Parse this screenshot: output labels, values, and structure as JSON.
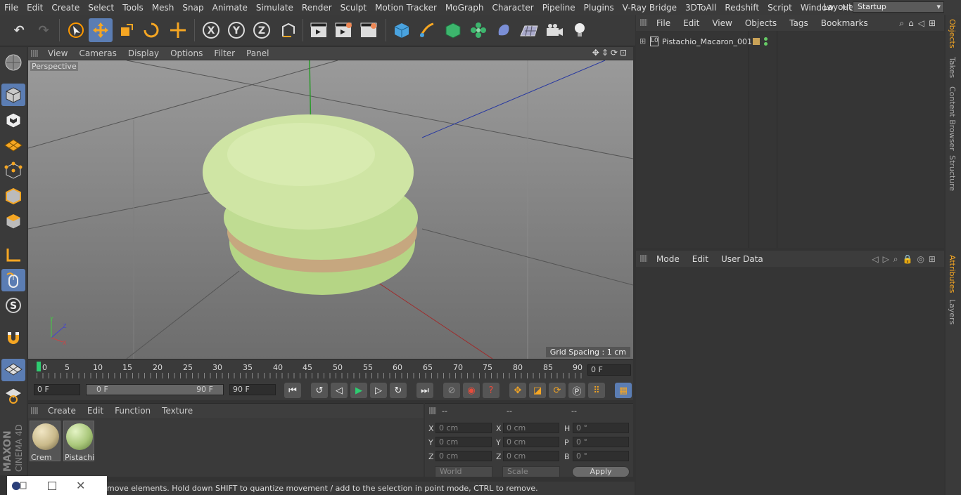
{
  "menubar": {
    "items": [
      "File",
      "Edit",
      "Create",
      "Select",
      "Tools",
      "Mesh",
      "Snap",
      "Animate",
      "Simulate",
      "Render",
      "Sculpt",
      "Motion Tracker",
      "MoGraph",
      "Character",
      "Pipeline",
      "Plugins",
      "V-Ray Bridge",
      "3DToAll",
      "Redshift",
      "Script",
      "Window",
      "Help"
    ],
    "layout_label": "Layout:",
    "layout_value": "Startup"
  },
  "viewport": {
    "menu": [
      "View",
      "Cameras",
      "Display",
      "Options",
      "Filter",
      "Panel"
    ],
    "label": "Perspective",
    "grid_spacing": "Grid Spacing : 1 cm"
  },
  "timeline": {
    "ticks": [
      "0",
      "5",
      "10",
      "15",
      "20",
      "25",
      "30",
      "35",
      "40",
      "45",
      "50",
      "55",
      "60",
      "65",
      "70",
      "75",
      "80",
      "85",
      "90"
    ],
    "current_frame": "0 F"
  },
  "transport": {
    "start": "0 F",
    "range_start": "0 F",
    "range_end": "90 F",
    "end": "90 F"
  },
  "materials": {
    "menu": [
      "Create",
      "Edit",
      "Function",
      "Texture"
    ],
    "items": [
      {
        "name": "Crem",
        "color": "#c9b98a"
      },
      {
        "name": "Pistachio",
        "color": "#a9c77a"
      }
    ]
  },
  "coords": {
    "headers": [
      "--",
      "--",
      "--"
    ],
    "rows": [
      {
        "a": "X",
        "av": "0 cm",
        "b": "X",
        "bv": "0 cm",
        "c": "H",
        "cv": "0 °"
      },
      {
        "a": "Y",
        "av": "0 cm",
        "b": "Y",
        "bv": "0 cm",
        "c": "P",
        "cv": "0 °"
      },
      {
        "a": "Z",
        "av": "0 cm",
        "b": "Z",
        "bv": "0 cm",
        "c": "B",
        "cv": "0 °"
      }
    ],
    "world": "World",
    "scale": "Scale",
    "apply": "Apply"
  },
  "status": "move elements. Hold down SHIFT to quantize movement / add to the selection in point mode, CTRL to remove.",
  "objects": {
    "menu": [
      "File",
      "Edit",
      "View",
      "Objects",
      "Tags",
      "Bookmarks"
    ],
    "item": "Pistachio_Macaron_001"
  },
  "attributes": {
    "menu": [
      "Mode",
      "Edit",
      "User Data"
    ]
  },
  "right_tabs": [
    "Objects",
    "Takes",
    "Content Browser",
    "Structure",
    "Attributes",
    "Layers"
  ],
  "brand": {
    "maxon": "MAXON",
    "cinema": "CINEMA 4D"
  }
}
